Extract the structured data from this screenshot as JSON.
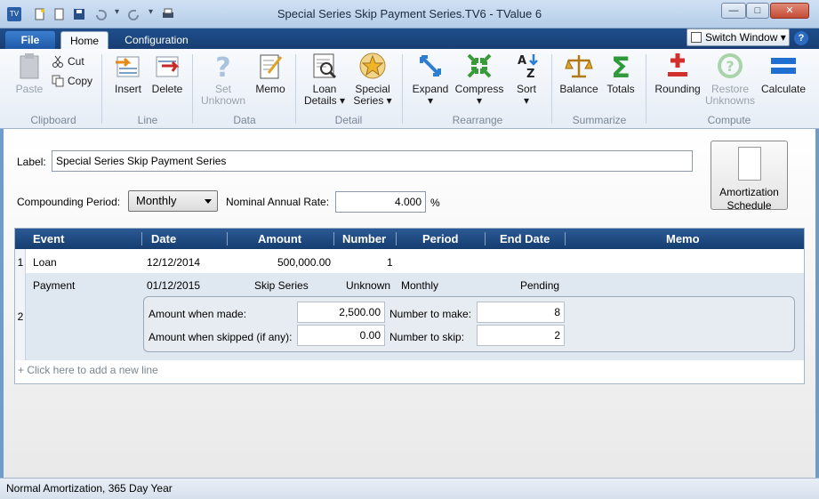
{
  "window": {
    "title": "Special Series Skip Payment Series.TV6 - TValue 6",
    "minimize": "—",
    "maximize": "□",
    "close": "✕"
  },
  "tabs": {
    "file": "File",
    "home": "Home",
    "configuration": "Configuration",
    "switch_window": "Switch Window ▾",
    "help": "?"
  },
  "ribbon": {
    "clipboard": {
      "paste": "Paste",
      "cut": "Cut",
      "copy": "Copy",
      "group": "Clipboard"
    },
    "line": {
      "insert": "Insert",
      "delete": "Delete",
      "group": "Line"
    },
    "data": {
      "set_unknown_1": "Set",
      "set_unknown_2": "Unknown",
      "memo": "Memo",
      "group": "Data"
    },
    "detail": {
      "loan_details_1": "Loan",
      "loan_details_2": "Details ▾",
      "special_series_1": "Special",
      "special_series_2": "Series ▾",
      "group": "Detail"
    },
    "rearrange": {
      "expand": "Expand",
      "compress": "Compress",
      "sort": "Sort",
      "dropdown": "▾",
      "group": "Rearrange"
    },
    "summarize": {
      "balance": "Balance",
      "totals": "Totals",
      "group": "Summarize"
    },
    "compute": {
      "rounding": "Rounding",
      "restore_1": "Restore",
      "restore_2": "Unknowns",
      "calculate": "Calculate",
      "group": "Compute"
    }
  },
  "form": {
    "label_caption": "Label:",
    "label_value": "Special Series Skip Payment Series",
    "compounding_caption": "Compounding Period:",
    "compounding_value": "Monthly",
    "rate_caption": "Nominal Annual Rate:",
    "rate_value": "4.000",
    "rate_unit": "%",
    "amortization_1": "Amortization",
    "amortization_2": "Schedule"
  },
  "grid": {
    "columns": [
      "Event",
      "Date",
      "Amount",
      "Number",
      "Period",
      "End Date",
      "Memo"
    ],
    "rows": [
      {
        "num": "1",
        "event": "Loan",
        "date": "12/12/2014",
        "amount": "500,000.00",
        "number": "1",
        "period": "",
        "end_date": ""
      },
      {
        "num": "2",
        "event": "Payment",
        "date": "01/12/2015",
        "amount": "Skip Series",
        "number": "Unknown",
        "period": "Monthly",
        "end_date": "Pending"
      }
    ],
    "series": {
      "amount_when_made_label": "Amount when made:",
      "amount_when_made": "2,500.00",
      "amount_when_skipped_label": "Amount when skipped (if any):",
      "amount_when_skipped": "0.00",
      "number_to_make_label": "Number to make:",
      "number_to_make": "8",
      "number_to_skip_label": "Number to skip:",
      "number_to_skip": "2"
    },
    "add_line": "+  Click here to add a new line"
  },
  "status": {
    "text": "Normal Amortization, 365 Day Year"
  }
}
